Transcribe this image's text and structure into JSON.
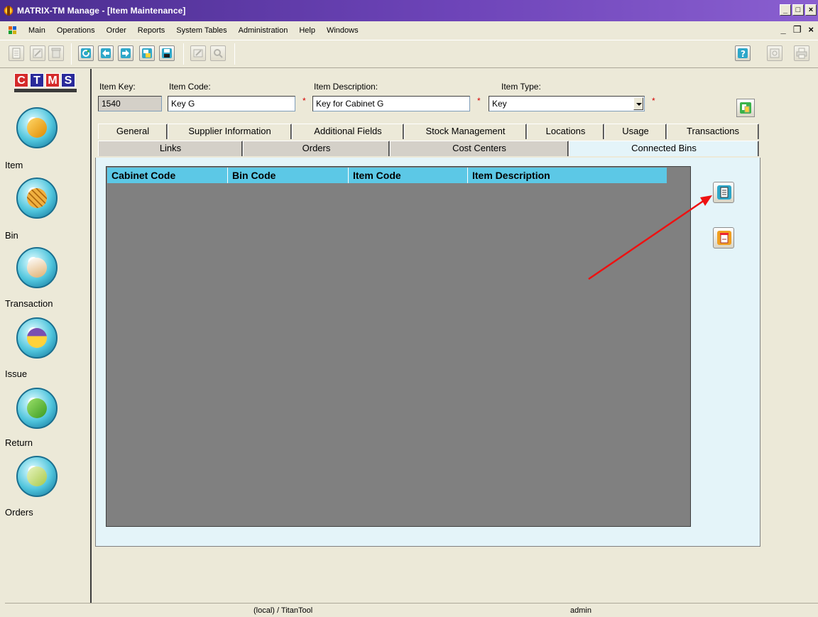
{
  "window": {
    "title": "MATRIX-TM Manage - [Item Maintenance]",
    "controls": [
      "_",
      "□",
      "×"
    ]
  },
  "menu": {
    "items": [
      "Main",
      "Operations",
      "Order",
      "Reports",
      "System Tables",
      "Administration",
      "Help",
      "Windows"
    ],
    "mdi_controls": [
      "_",
      "❐",
      "×"
    ]
  },
  "toolbar": {
    "buttons": [
      "new-doc-icon",
      "edit-icon",
      "delete-icon",
      "refresh-icon",
      "previous-icon",
      "next-icon",
      "save-as-icon",
      "save-icon",
      "edit-pen-icon",
      "find-icon",
      "help-icon",
      "preview-icon",
      "print-icon"
    ]
  },
  "nav": {
    "logo": [
      "C",
      "T",
      "M",
      "S"
    ],
    "items": [
      {
        "label": "Item",
        "icon": "item-box-icon"
      },
      {
        "label": "Bin",
        "icon": "bin-grid-icon"
      },
      {
        "label": "Transaction",
        "icon": "transaction-icon"
      },
      {
        "label": "Issue",
        "icon": "issue-icon"
      },
      {
        "label": "Return",
        "icon": "return-icon"
      },
      {
        "label": "Orders",
        "icon": "orders-icon"
      }
    ]
  },
  "form": {
    "item_key_label": "Item Key:",
    "item_key_value": "1540",
    "item_code_label": "Item Code:",
    "item_code_value": "Key G",
    "item_desc_label": "Item Description:",
    "item_desc_value": "Key for Cabinet G",
    "item_type_label": "Item Type:",
    "item_type_value": "Key",
    "required_mark": "*"
  },
  "tabs": {
    "row1": [
      "General",
      "Supplier Information",
      "Additional Fields",
      "Stock Management",
      "Locations",
      "Usage",
      "Transactions"
    ],
    "row2": [
      "Links",
      "Orders",
      "Cost Centers",
      "Connected Bins"
    ],
    "active": "Connected Bins"
  },
  "grid": {
    "columns": [
      "Cabinet Code",
      "Bin Code",
      "Item Code",
      "Item Description"
    ],
    "rows": []
  },
  "status": {
    "connection": "(local) / TitanTool",
    "user": "admin"
  },
  "colors": {
    "titlebar": "#6d44b8",
    "grid_header": "#5cc8e6",
    "panel": "#e4f4f9",
    "annotation_arrow": "#ee1111"
  }
}
